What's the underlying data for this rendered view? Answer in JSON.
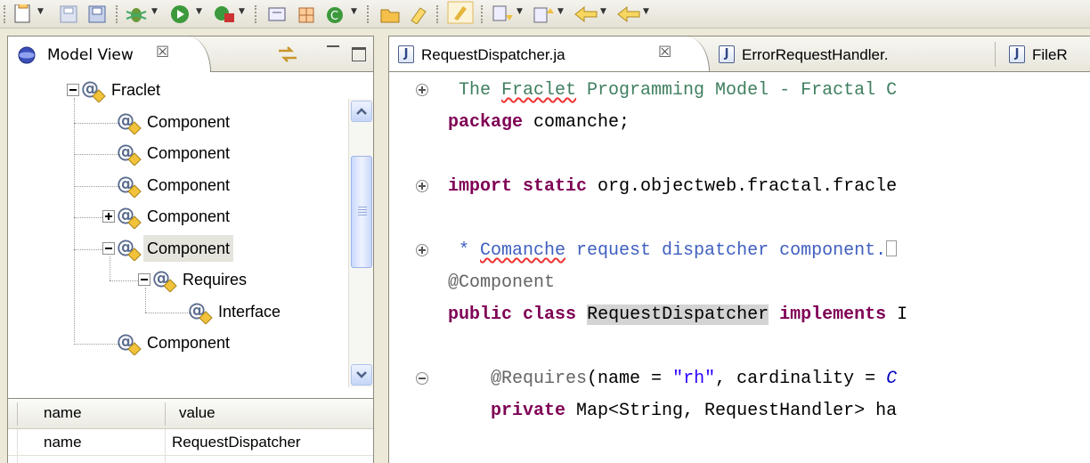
{
  "left_panel": {
    "tab_title": "Model View",
    "tab_close": "☒",
    "tree": [
      {
        "label": "Fraclet",
        "level": 0,
        "expander": "minus"
      },
      {
        "label": "Component",
        "level": 1,
        "expander": "none"
      },
      {
        "label": "Component",
        "level": 1,
        "expander": "none"
      },
      {
        "label": "Component",
        "level": 1,
        "expander": "none"
      },
      {
        "label": "Component",
        "level": 1,
        "expander": "plus"
      },
      {
        "label": "Component",
        "level": 1,
        "expander": "minus",
        "selected": true
      },
      {
        "label": "Requires",
        "level": 2,
        "expander": "minus"
      },
      {
        "label": "Interface",
        "level": 3,
        "expander": "none"
      },
      {
        "label": "Component",
        "level": 1,
        "expander": "none",
        "partial": true
      }
    ],
    "properties": {
      "headers": [
        "name",
        "value"
      ],
      "rows": [
        {
          "name": "name",
          "value": "RequestDispatcher"
        }
      ]
    }
  },
  "editor": {
    "tabs": [
      {
        "label": "RequestDispatcher.ja",
        "active": true,
        "close": "☒"
      },
      {
        "label": "ErrorRequestHandler.",
        "active": false
      },
      {
        "label": "FileR",
        "active": false
      }
    ],
    "code": [
      {
        "fold": "plus",
        "parts": [
          {
            "t": " The ",
            "c": "cm"
          },
          {
            "t": "Fraclet",
            "c": "cm squig"
          },
          {
            "t": " Programming Model - Fractal C",
            "c": "cm"
          }
        ]
      },
      {
        "fold": "none",
        "parts": [
          {
            "t": "package",
            "c": "kw"
          },
          {
            "t": " comanche;",
            "c": ""
          }
        ]
      },
      {
        "fold": "none",
        "parts": []
      },
      {
        "fold": "plus",
        "parts": [
          {
            "t": "import",
            "c": "kw"
          },
          {
            "t": " ",
            "c": ""
          },
          {
            "t": "static",
            "c": "kw"
          },
          {
            "t": " org.objectweb.fractal.fracle",
            "c": ""
          }
        ]
      },
      {
        "fold": "none",
        "parts": []
      },
      {
        "fold": "plus",
        "parts": [
          {
            "t": " * ",
            "c": "jd"
          },
          {
            "t": "Comanche",
            "c": "jd squig"
          },
          {
            "t": " request dispatcher component.",
            "c": "jd"
          }
        ]
      },
      {
        "fold": "none",
        "parts": [
          {
            "t": "@Component",
            "c": "an"
          }
        ]
      },
      {
        "fold": "none",
        "parts": [
          {
            "t": "public",
            "c": "kw"
          },
          {
            "t": " ",
            "c": ""
          },
          {
            "t": "class",
            "c": "kw"
          },
          {
            "t": " ",
            "c": ""
          },
          {
            "t": "RequestDispatcher",
            "c": "hl"
          },
          {
            "t": " ",
            "c": ""
          },
          {
            "t": "implements",
            "c": "kw"
          },
          {
            "t": " I",
            "c": ""
          }
        ]
      },
      {
        "fold": "none",
        "parts": []
      },
      {
        "fold": "minus",
        "parts": [
          {
            "t": "    ",
            "c": ""
          },
          {
            "t": "@Requires",
            "c": "an"
          },
          {
            "t": "(name = ",
            "c": ""
          },
          {
            "t": "\"rh\"",
            "c": "st"
          },
          {
            "t": ", cardinality = ",
            "c": ""
          },
          {
            "t": "C",
            "c": "it"
          }
        ]
      },
      {
        "fold": "none",
        "parts": [
          {
            "t": "    ",
            "c": ""
          },
          {
            "t": "private",
            "c": "kw"
          },
          {
            "t": " Map<String, RequestHandler> ha",
            "c": ""
          }
        ]
      }
    ]
  },
  "colors": {
    "keyword": "#7f0055",
    "comment": "#3f7f5f",
    "javadoc": "#3f5fbf",
    "annotation": "#646464",
    "string": "#2a00ff",
    "field": "#0000c0",
    "selection": "#e5e5de"
  }
}
